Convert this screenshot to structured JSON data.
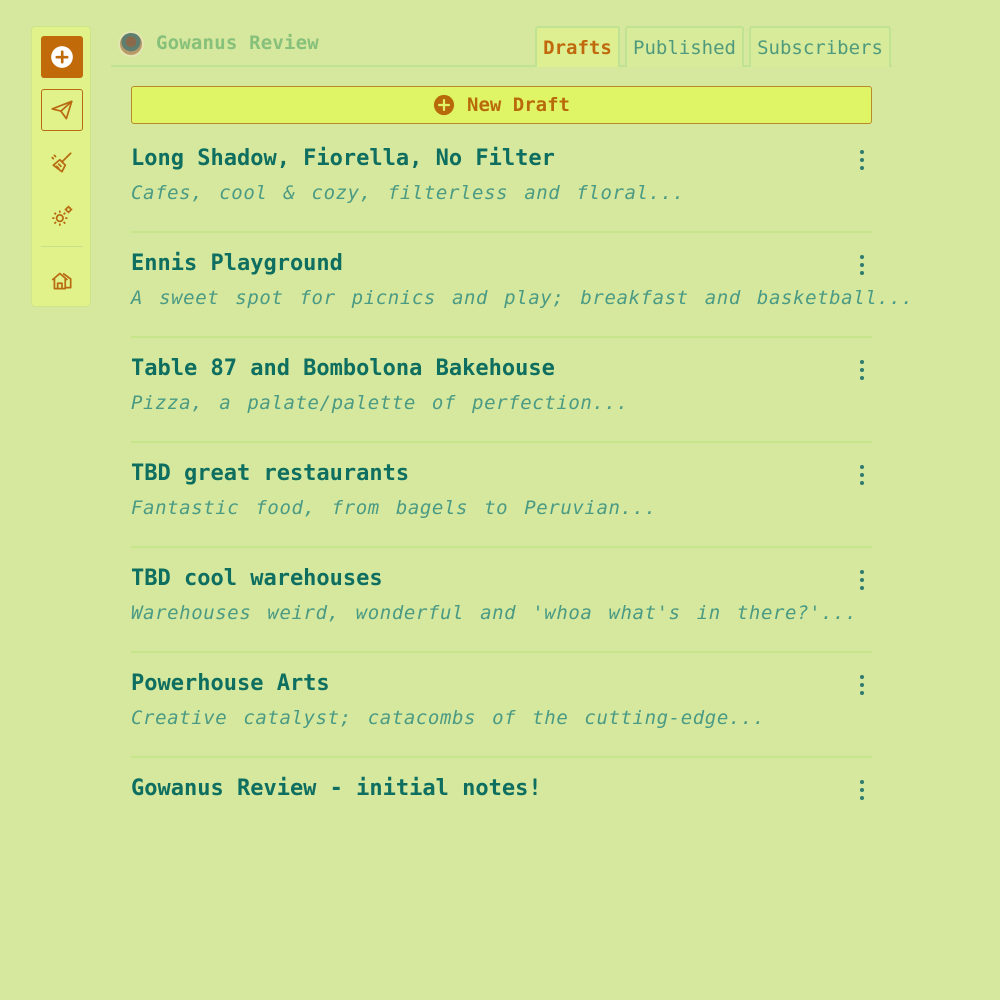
{
  "app": {
    "site_title": "Gowanus Review"
  },
  "sidebar": {
    "items": [
      {
        "name": "new-draft",
        "icon": "plus-circle-icon"
      },
      {
        "name": "send",
        "icon": "paper-plane-icon"
      },
      {
        "name": "clean",
        "icon": "broom-icon"
      },
      {
        "name": "settings",
        "icon": "gear-icon"
      },
      {
        "name": "home",
        "icon": "house-icon"
      }
    ]
  },
  "tabs": {
    "drafts": "Drafts",
    "published": "Published",
    "subscribers": "Subscribers"
  },
  "actions": {
    "new_draft_label": "New Draft"
  },
  "drafts": [
    {
      "title": "Long Shadow, Fiorella, No Filter",
      "excerpt": "Cafes, cool & cozy, filterless and floral..."
    },
    {
      "title": "Ennis Playground",
      "excerpt": "A sweet spot for picnics and play; breakfast and basketball..."
    },
    {
      "title": "Table 87 and Bombolona Bakehouse",
      "excerpt": "Pizza, a palate/palette of perfection..."
    },
    {
      "title": "TBD great restaurants",
      "excerpt": "Fantastic food, from bagels to Peruvian..."
    },
    {
      "title": "TBD cool warehouses",
      "excerpt": "Warehouses weird, wonderful and 'whoa what's in there?'..."
    },
    {
      "title": "Powerhouse Arts",
      "excerpt": "Creative catalyst; catacombs of the cutting-edge..."
    },
    {
      "title": "Gowanus Review - initial notes!",
      "excerpt": ""
    }
  ],
  "colors": {
    "background": "#d6e89d",
    "accent": "#c0690c",
    "title": "#0e6e60",
    "excerpt": "#4a9a84"
  }
}
